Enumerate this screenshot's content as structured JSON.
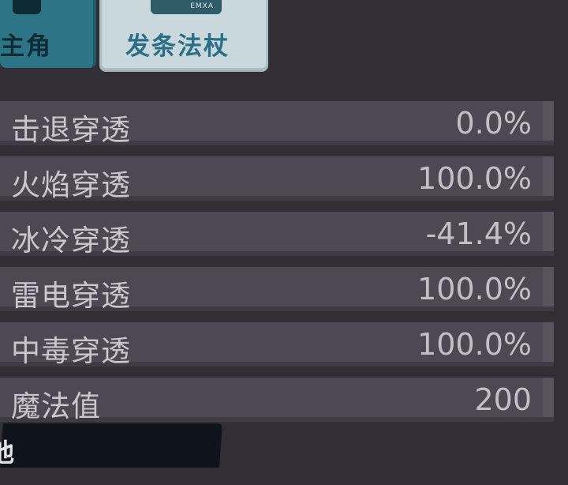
{
  "tabs": [
    {
      "label": "主角"
    },
    {
      "label": "发条法杖",
      "icon_text": "EMXA"
    }
  ],
  "stats": [
    {
      "label": "击退穿透",
      "value": "0.0%"
    },
    {
      "label": "火焰穿透",
      "value": "100.0%"
    },
    {
      "label": "冰冷穿透",
      "value": "-41.4%"
    },
    {
      "label": "雷电穿透",
      "value": "100.0%"
    },
    {
      "label": "中毒穿透",
      "value": "100.0%"
    },
    {
      "label": "魔法值",
      "value": "200"
    }
  ],
  "bottom_bar": {
    "label": "池"
  }
}
